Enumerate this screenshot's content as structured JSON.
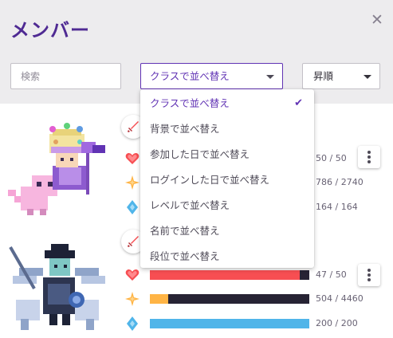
{
  "header": {
    "title": "メンバー",
    "close_glyph": "✕"
  },
  "controls": {
    "search_placeholder": "検索",
    "sort_value": "クラスで並べ替え",
    "order_value": "昇順"
  },
  "sort_menu": {
    "items": [
      {
        "label": "クラスで並べ替え",
        "selected": true
      },
      {
        "label": "背景で並べ替え"
      },
      {
        "label": "参加した日で並べ替え"
      },
      {
        "label": "ログインした日で並べ替え"
      },
      {
        "label": "レベルで並べ替え"
      },
      {
        "label": "名前で並べ替え"
      },
      {
        "label": "段位で並べ替え"
      }
    ],
    "check_glyph": "✔"
  },
  "members": [
    {
      "class_icon": "sword-icon",
      "health": {
        "text": "50 / 50",
        "fraction": 1.0
      },
      "experience": {
        "text": "786 / 2740",
        "fraction": 0.287
      },
      "mana": {
        "text": "164 / 164",
        "fraction": 1.0
      }
    },
    {
      "class_icon": "sword-icon",
      "health": {
        "text": "47 / 50",
        "fraction": 0.94
      },
      "experience": {
        "text": "504 / 4460",
        "fraction": 0.113
      },
      "mana": {
        "text": "200 / 200",
        "fraction": 1.0
      }
    }
  ],
  "colors": {
    "title": "#4f2a93",
    "accent": "#6133b4",
    "health": "#f74e52",
    "experience": "#ffb445",
    "mana": "#50b5e9",
    "bar_bg": "#272334",
    "header_bg": "#edecee"
  }
}
